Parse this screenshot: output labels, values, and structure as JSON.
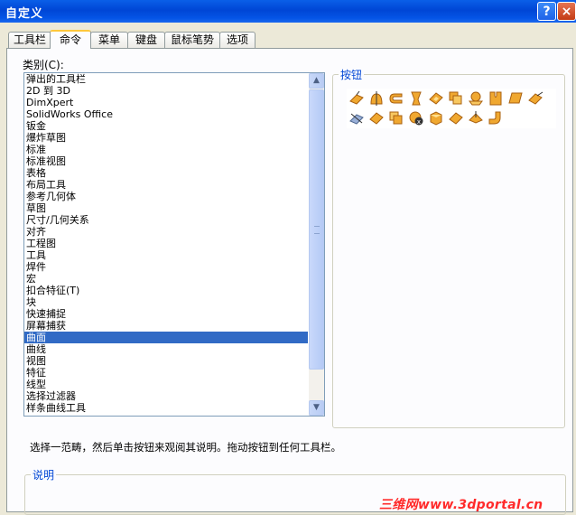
{
  "window": {
    "title": "自定义",
    "help_label": "?",
    "close_label": "×"
  },
  "tabs": [
    {
      "label": "工具栏"
    },
    {
      "label": "命令"
    },
    {
      "label": "菜单"
    },
    {
      "label": "键盘"
    },
    {
      "label": "鼠标笔势"
    },
    {
      "label": "选项"
    }
  ],
  "categories": {
    "label": "类别(C):",
    "items": [
      "弹出的工具栏",
      "2D 到 3D",
      "DimXpert",
      "SolidWorks Office",
      "钣金",
      "爆炸草图",
      "标准",
      "标准视图",
      "表格",
      "布局工具",
      "参考几何体",
      "草图",
      "尺寸/几何关系",
      "对齐",
      "工程图",
      "工具",
      "焊件",
      "宏",
      "扣合特征(T)",
      "块",
      "快速捕捉",
      "屏幕捕获",
      "曲面",
      "曲线",
      "视图",
      "特征",
      "线型",
      "选择过滤器",
      "样条曲线工具"
    ],
    "selected": "曲面"
  },
  "buttons_group": {
    "legend": "按钮",
    "icons": [
      "extruded-surface-icon",
      "revolved-surface-icon",
      "swept-surface-icon",
      "lofted-surface-icon",
      "boundary-surface-icon",
      "offset-surface-icon",
      "radiated-surface-icon",
      "knit-surface-icon",
      "planar-surface-icon",
      "extend-surface-icon",
      "trim-surface-icon",
      "untrim-surface-icon",
      "fill-surface-icon",
      "delete-face-icon",
      "replace-face-icon",
      "thicken-icon",
      "ruled-surface-icon",
      "mid-surface-icon",
      "flatten-surface-icon"
    ]
  },
  "hint": "选择一范畴，然后单击按钮来观阅其说明。拖动按钮到任何工具栏。",
  "description_group": {
    "legend": "说明"
  },
  "watermark": "三维网www.3dportal.cn",
  "colors": {
    "selection": "#316AC5",
    "icon_orange": "#F0A830",
    "titlebar": "#0046D5"
  }
}
